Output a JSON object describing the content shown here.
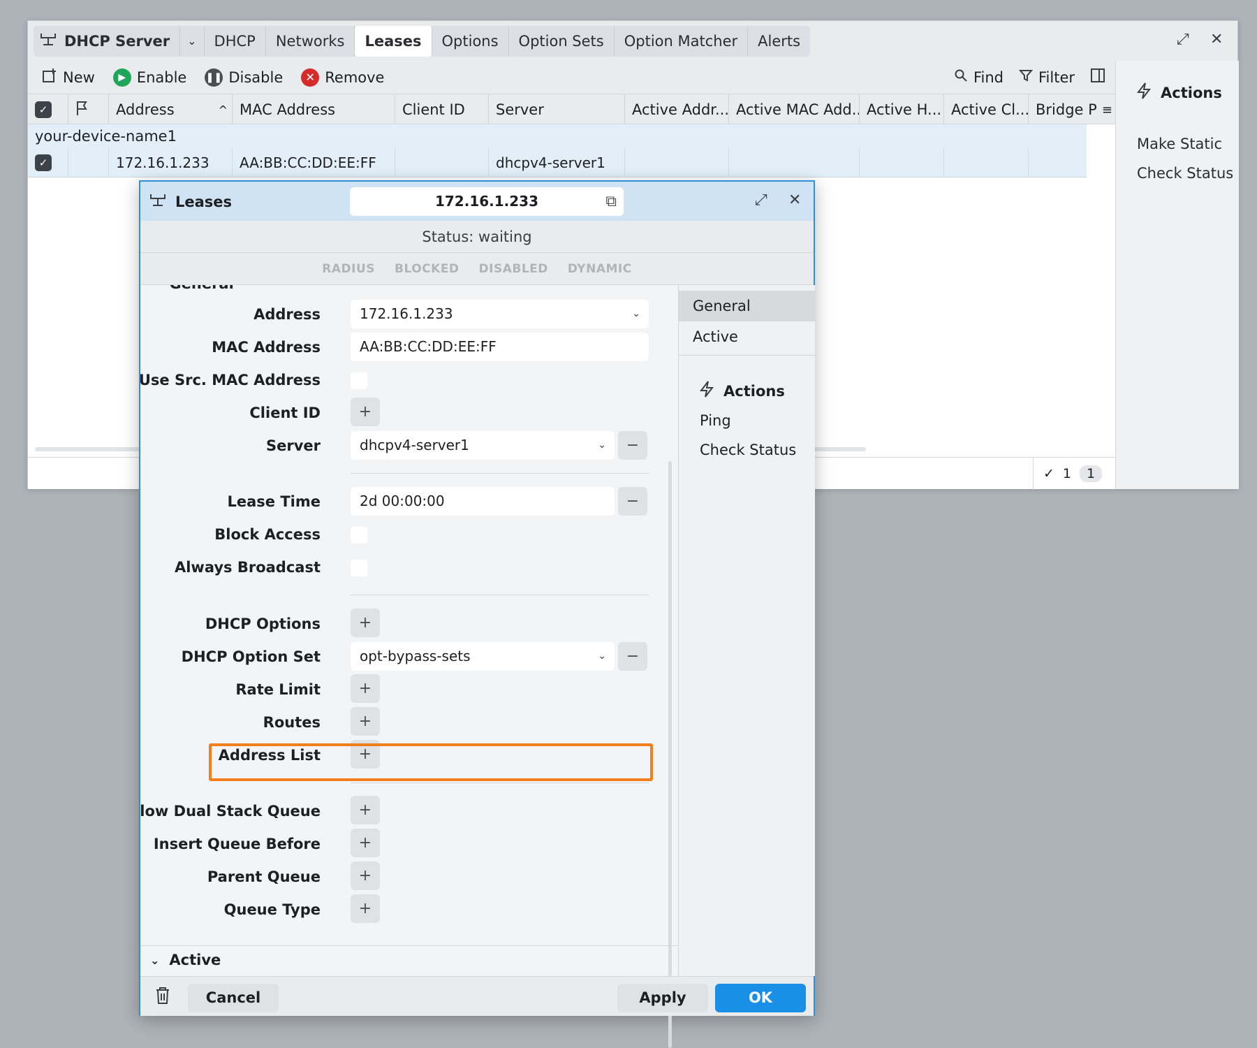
{
  "window": {
    "app_title": "DHCP Server",
    "tabs": [
      "DHCP",
      "Networks",
      "Leases",
      "Options",
      "Option Sets",
      "Option Matcher",
      "Alerts"
    ],
    "active_tab": "Leases"
  },
  "toolbar": {
    "new": "New",
    "enable": "Enable",
    "disable": "Disable",
    "remove": "Remove",
    "find": "Find",
    "filter": "Filter"
  },
  "grid": {
    "columns": [
      "Address",
      "MAC Address",
      "Client ID",
      "Server",
      "Active Addr...",
      "Active MAC Add...",
      "Active H...",
      "Active Cl...",
      "Bridge P"
    ],
    "group_label": "your-device-name1",
    "row": {
      "address": "172.16.1.233",
      "mac": "AA:BB:CC:DD:EE:FF",
      "client_id": "",
      "server": "dhcpv4-server1"
    }
  },
  "side_actions": {
    "title": "Actions",
    "items": [
      "Make Static",
      "Check Status"
    ]
  },
  "status_bar": {
    "selected": "1",
    "total": "1"
  },
  "dialog": {
    "title": "Leases",
    "address": "172.16.1.233",
    "status": "Status: waiting",
    "flags": [
      "RADIUS",
      "BLOCKED",
      "DISABLED",
      "DYNAMIC"
    ],
    "section_general": "General",
    "section_active": "Active",
    "fields": {
      "address_label": "Address",
      "address_value": "172.16.1.233",
      "mac_label": "MAC Address",
      "mac_value": "AA:BB:CC:DD:EE:FF",
      "use_src_mac_label": "Use Src. MAC Address",
      "client_id_label": "Client ID",
      "server_label": "Server",
      "server_value": "dhcpv4-server1",
      "lease_time_label": "Lease Time",
      "lease_time_value": "2d 00:00:00",
      "block_access_label": "Block Access",
      "always_broadcast_label": "Always Broadcast",
      "dhcp_options_label": "DHCP Options",
      "dhcp_option_set_label": "DHCP Option Set",
      "dhcp_option_set_value": "opt-bypass-sets",
      "rate_limit_label": "Rate Limit",
      "routes_label": "Routes",
      "address_list_label": "Address List",
      "allow_dual_stack_label": "Allow Dual Stack Queue",
      "insert_queue_before_label": "Insert Queue Before",
      "parent_queue_label": "Parent Queue",
      "queue_type_label": "Queue Type"
    },
    "side_nav": [
      "General",
      "Active"
    ],
    "side_actions_title": "Actions",
    "side_actions": [
      "Ping",
      "Check Status"
    ],
    "footer": {
      "cancel": "Cancel",
      "apply": "Apply",
      "ok": "OK"
    }
  },
  "colors": {
    "accent": "#1a8fe8",
    "highlight": "#f07e1c",
    "enable_green": "#1fa65a",
    "remove_red": "#d62b2b",
    "dialog_border": "#2f8fd8"
  }
}
